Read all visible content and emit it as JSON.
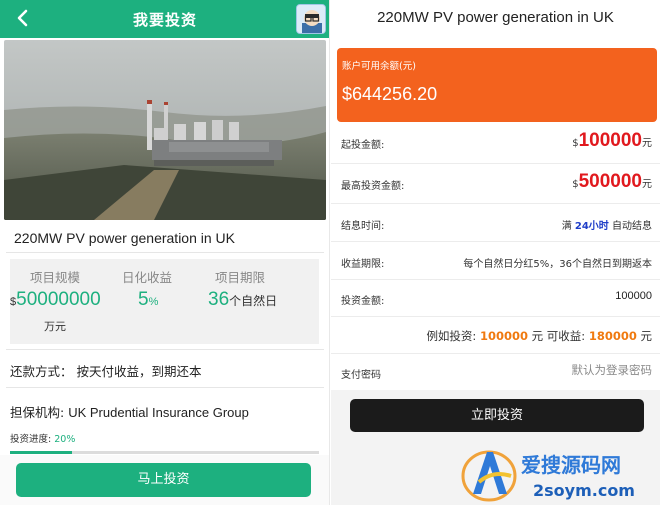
{
  "left": {
    "header": {
      "title": "我要投资"
    },
    "project_name": "220MW PV power generation in UK",
    "stats": {
      "scale_label": "项目规模",
      "scale_currency": "$",
      "scale_value": "50000000",
      "scale_unit": "万元",
      "daily_label": "日化收益",
      "daily_value": "5",
      "daily_unit": "%",
      "term_label": "项目期限",
      "term_value": "36",
      "term_unit": "个自然日"
    },
    "repayment": "还款方式：  按天付收益，到期还本",
    "guarantor_label": "担保机构:",
    "guarantor_value": "UK Prudential Insurance Group",
    "progress_label": "投资进度:",
    "progress_value": "20%",
    "progress_fraction": 0.2,
    "invest_button": "马上投资"
  },
  "right": {
    "title": "220MW PV power generation in UK",
    "balance_label": "账户可用余额(元)",
    "balance_value": "$644256.20",
    "rows": {
      "min_label": "起投金额:",
      "min_currency": "$",
      "min_value": "100000",
      "min_unit": "元",
      "max_label": "最高投资金额:",
      "max_currency": "$",
      "max_value": "500000",
      "max_unit": "元",
      "settle_label": "结息时间:",
      "settle_prefix": "满",
      "settle_highlight": "24小时",
      "settle_suffix": "自动结息",
      "income_label": "收益期限:",
      "income_value": "每个自然日分红5%，36个自然日到期返本",
      "amount_label": "投资金额:",
      "amount_value": "100000",
      "example_prefix": "例如投资:",
      "example_invest": "100000",
      "example_mid": "元 可收益:",
      "example_income": "180000",
      "example_unit": "元",
      "password_label": "支付密码",
      "password_placeholder": "默认为登录密码"
    },
    "invest_button": "立即投资"
  },
  "watermark": {
    "cn": "爱搜源码网",
    "en": "2soym.com"
  },
  "colors": {
    "green": "#1db07f",
    "orange_card": "#f3621e",
    "red_value": "#e1191e",
    "blue_text": "#1f3ec8",
    "orange_text": "#f07a10",
    "dark_button": "#1b1b1b"
  },
  "icons": [
    "back-arrow-icon",
    "avatar-icon"
  ]
}
